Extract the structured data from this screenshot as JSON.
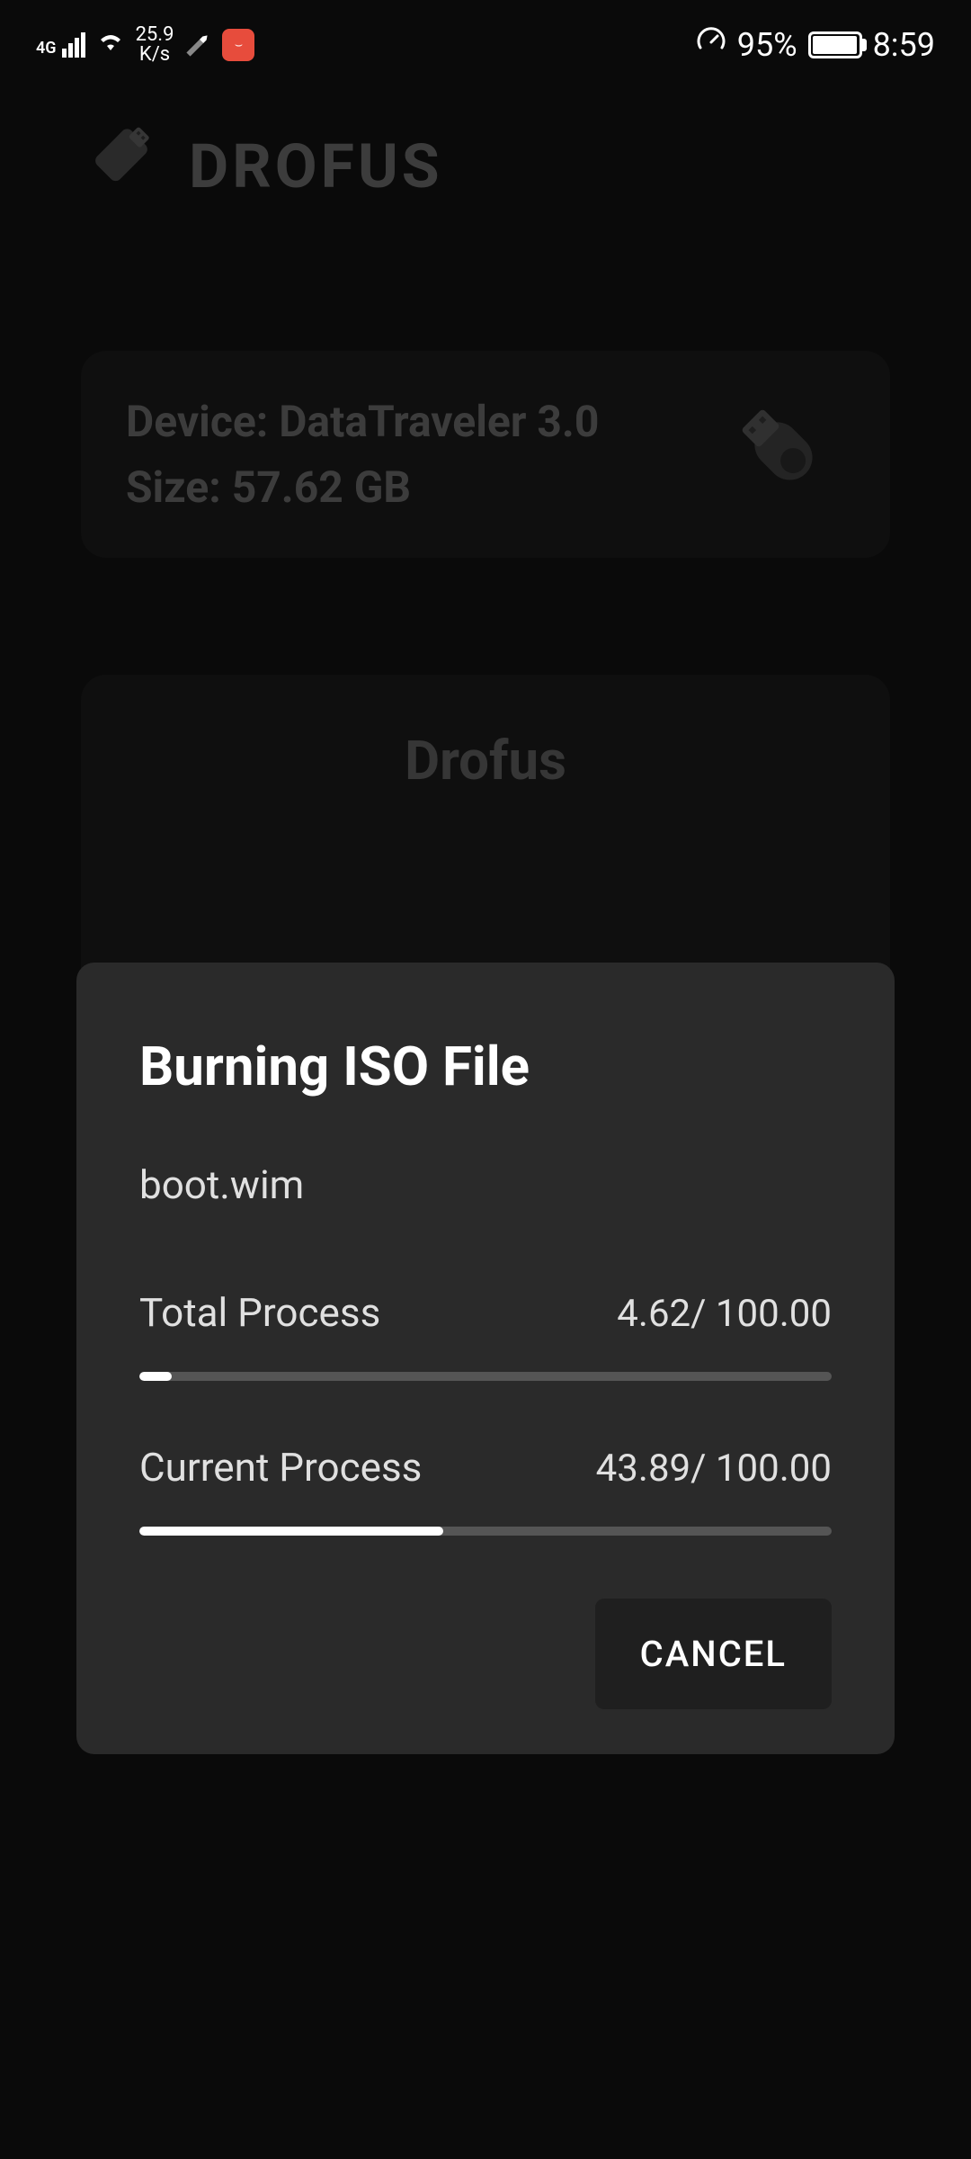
{
  "status_bar": {
    "network_type": "4G",
    "speed_value": "25.9",
    "speed_unit": "K/s",
    "battery_percent": "95%",
    "time": "8:59"
  },
  "app": {
    "title": "DROFUS"
  },
  "device": {
    "name_label": "Device:",
    "name_value": "DataTraveler 3.0",
    "size_label": "Size:",
    "size_value": "57.62 GB"
  },
  "panel": {
    "title": "Drofus"
  },
  "modal": {
    "title": "Burning ISO File",
    "filename": "boot.wim",
    "total": {
      "label": "Total Process",
      "value": "4.62/ 100.00",
      "percent": 4.62
    },
    "current": {
      "label": "Current Process",
      "value": "43.89/ 100.00",
      "percent": 43.89
    },
    "cancel_label": "CANCEL"
  }
}
